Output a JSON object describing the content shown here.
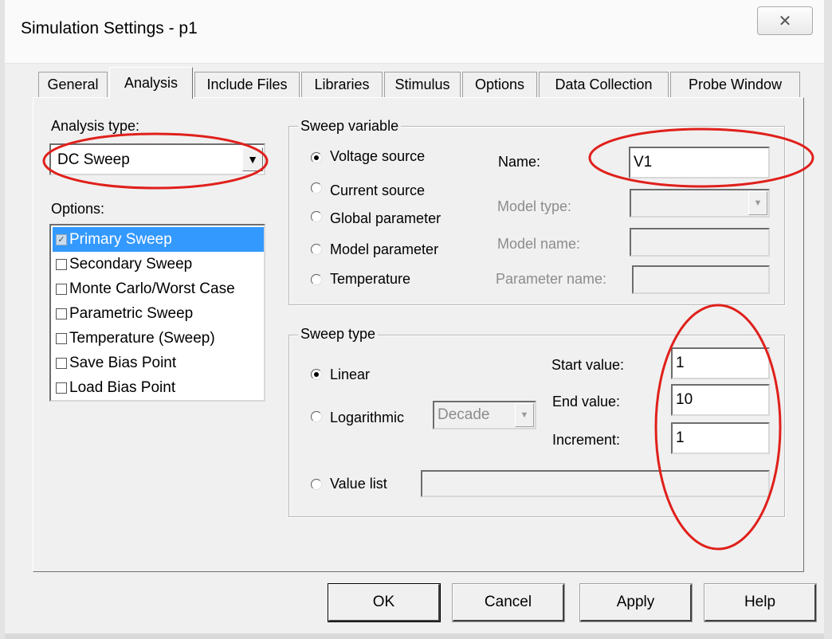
{
  "window": {
    "title": "Simulation Settings - p1",
    "close_glyph": "✕"
  },
  "tabs": [
    {
      "label": "General",
      "active": false
    },
    {
      "label": "Analysis",
      "active": true
    },
    {
      "label": "Include Files",
      "active": false
    },
    {
      "label": "Libraries",
      "active": false
    },
    {
      "label": "Stimulus",
      "active": false
    },
    {
      "label": "Options",
      "active": false
    },
    {
      "label": "Data Collection",
      "active": false
    },
    {
      "label": "Probe Window",
      "active": false
    }
  ],
  "analysis": {
    "type_label": "Analysis type:",
    "type_value": "DC Sweep",
    "options_label": "Options:",
    "options": [
      {
        "label": "Primary Sweep",
        "checked": true,
        "selected": true
      },
      {
        "label": "Secondary Sweep",
        "checked": false
      },
      {
        "label": "Monte Carlo/Worst Case",
        "checked": false
      },
      {
        "label": "Parametric Sweep",
        "checked": false
      },
      {
        "label": "Temperature (Sweep)",
        "checked": false
      },
      {
        "label": "Save Bias Point",
        "checked": false
      },
      {
        "label": "Load Bias Point",
        "checked": false
      }
    ]
  },
  "sweep_variable": {
    "title": "Sweep variable",
    "options": [
      {
        "label": "Voltage source",
        "selected": true
      },
      {
        "label": "Current source",
        "selected": false
      },
      {
        "label": "Global parameter",
        "selected": false
      },
      {
        "label": "Model parameter",
        "selected": false
      },
      {
        "label": "Temperature",
        "selected": false
      }
    ],
    "name_label": "Name:",
    "name_value": "V1",
    "model_type_label": "Model type:",
    "model_name_label": "Model name:",
    "parameter_name_label": "Parameter name:"
  },
  "sweep_type": {
    "title": "Sweep type",
    "linear_label": "Linear",
    "log_label": "Logarithmic",
    "log_scale": "Decade",
    "value_list_label": "Value list",
    "start_label": "Start value:",
    "start_value": "1",
    "end_label": "End value:",
    "end_value": "10",
    "increment_label": "Increment:",
    "increment_value": "1"
  },
  "buttons": {
    "ok": "OK",
    "cancel": "Cancel",
    "apply": "Apply",
    "help": "Help"
  },
  "annotation": {
    "color": "#e0201b"
  }
}
